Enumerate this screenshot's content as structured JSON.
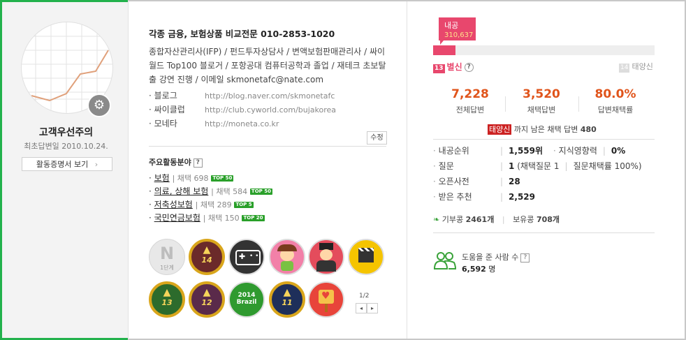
{
  "profile": {
    "nickname": "고객우선주의",
    "first_answer": "최초답변일 2010.10.24.",
    "cert_button": "활동증명서 보기",
    "cert_chevron": "›"
  },
  "intro": {
    "title": "각종 금융, 보험상품 비교전문 010-2853-1020",
    "description": "종합자산관리사(IFP) / 펀드투자상담사 / 변액보험판매관리사 / 싸이월드 Top100 블로거 / 포항공대 컴퓨터공학과 졸업 / 재테크 초보탈출 강연 진행 / 이메일 skmonetafc@nate.com",
    "links": [
      {
        "label": "· 블로그",
        "url": "http://blog.naver.com/skmonetafc"
      },
      {
        "label": "· 싸이클럽",
        "url": "http://club.cyworld.com/bujakorea"
      },
      {
        "label": "· 모네타",
        "url": "http://moneta.co.kr"
      }
    ],
    "edit_button": "수정"
  },
  "areas": {
    "title": "주요활동분야",
    "help": "?",
    "items": [
      {
        "name": "보험",
        "count": "채택 698",
        "badge": "TOP 50"
      },
      {
        "name": "의료, 상해 보험",
        "count": "채택 584",
        "badge": "TOP 50"
      },
      {
        "name": "저축성보험",
        "count": "채택 289",
        "badge": "TOP 5"
      },
      {
        "name": "국민연금보험",
        "count": "채택 150",
        "badge": "TOP 20"
      }
    ]
  },
  "badges": {
    "items": [
      {
        "icon": "n-level1-badge-icon",
        "text": "1단계"
      },
      {
        "icon": "graduation-14-badge-icon",
        "text": "14"
      },
      {
        "icon": "gamepad-badge-icon",
        "text": ""
      },
      {
        "icon": "fairy-character-badge-icon",
        "text": ""
      },
      {
        "icon": "magician-character-badge-icon",
        "text": ""
      },
      {
        "icon": "clapperboard-badge-icon",
        "text": ""
      },
      {
        "icon": "graduation-13-badge-icon",
        "text": "13"
      },
      {
        "icon": "graduation-12-badge-icon",
        "text": "12"
      },
      {
        "icon": "brazil-2014-badge-icon",
        "text": "2014 Brazil"
      },
      {
        "icon": "graduation-11-badge-icon",
        "text": "11"
      },
      {
        "icon": "heart-sign-badge-icon",
        "text": ""
      }
    ],
    "page": "1/2",
    "prev": "◂",
    "next": "▸"
  },
  "grade": {
    "naegong_label": "내공",
    "naegong_value": "310,637",
    "progress_fraction": 0.1,
    "current_num": "13",
    "current": "별신",
    "help": "?",
    "next_num": "14",
    "next": "태양신"
  },
  "stats": [
    {
      "value": "7,228",
      "label": "전체답변"
    },
    {
      "value": "3,520",
      "label": "채택답변"
    },
    {
      "value": "80.0%",
      "label": "답변채택률"
    }
  ],
  "remaining": {
    "chip": "태양신",
    "text": " 까지 남은 채택 답변 ",
    "count": "480"
  },
  "info": {
    "rank_label": "내공순위",
    "rank_value": "1,559위",
    "influence_label": "지식영향력",
    "influence_value": "0%",
    "questions_label": "질문",
    "questions_value": "1",
    "questions_detail": "(채택질문 1",
    "questions_rate": "질문채택률 100%)",
    "opendict_label": "오픈사전",
    "opendict_value": "28",
    "recommend_label": "받은 추천",
    "recommend_value": "2,529",
    "bullet": "·"
  },
  "beans": {
    "donated_label": "기부콩",
    "donated_value": "2461개",
    "owned_label": "보유콩",
    "owned_value": "708개"
  },
  "helped": {
    "label": "도움을 준 사람 수",
    "help": "?",
    "value": "6,592",
    "unit": "명"
  },
  "colors": {
    "accent": "#e8476d",
    "stat": "#e0541b",
    "frame": "#22b14c"
  }
}
